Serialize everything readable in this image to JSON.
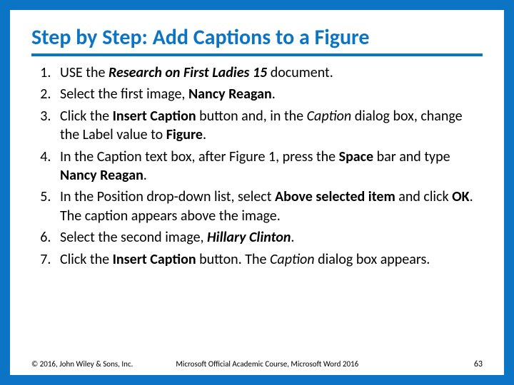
{
  "title": "Step by Step: Add Captions to a Figure",
  "steps": [
    {
      "pre": "USE the ",
      "b1": "Research on First Ladies 15",
      "post1": " document."
    },
    {
      "pre": "Select the first image, ",
      "b1": "Nancy Reagan",
      "post1": "."
    },
    {
      "pre": "Click the ",
      "b1": "Insert Caption",
      "mid1": " button and, in the ",
      "i1": "Caption",
      "mid2": " dialog box, change the Label value to ",
      "b2": "Figure",
      "post1": "."
    },
    {
      "pre": "In the Caption text box, after Figure 1, press the ",
      "b1": "Space",
      "mid1": " bar and type ",
      "b2": "Nancy Reagan",
      "post1": "."
    },
    {
      "pre": "In the Position drop-down list, select ",
      "b1": "Above selected item",
      "mid1": " and click ",
      "b2": "OK",
      "post1": ". The caption appears above the image."
    },
    {
      "pre": "Select the second image, ",
      "bi1": "Hillary Clinton",
      "post1": "."
    },
    {
      "pre": "Click the ",
      "b1": "Insert Caption",
      "mid1": " button. The ",
      "i1": "Caption",
      "post1": " dialog box appears."
    }
  ],
  "footer": {
    "copyright": "© 2016, John Wiley & Sons, Inc.",
    "course": "Microsoft Official Academic Course, Microsoft Word 2016",
    "page": "63"
  }
}
